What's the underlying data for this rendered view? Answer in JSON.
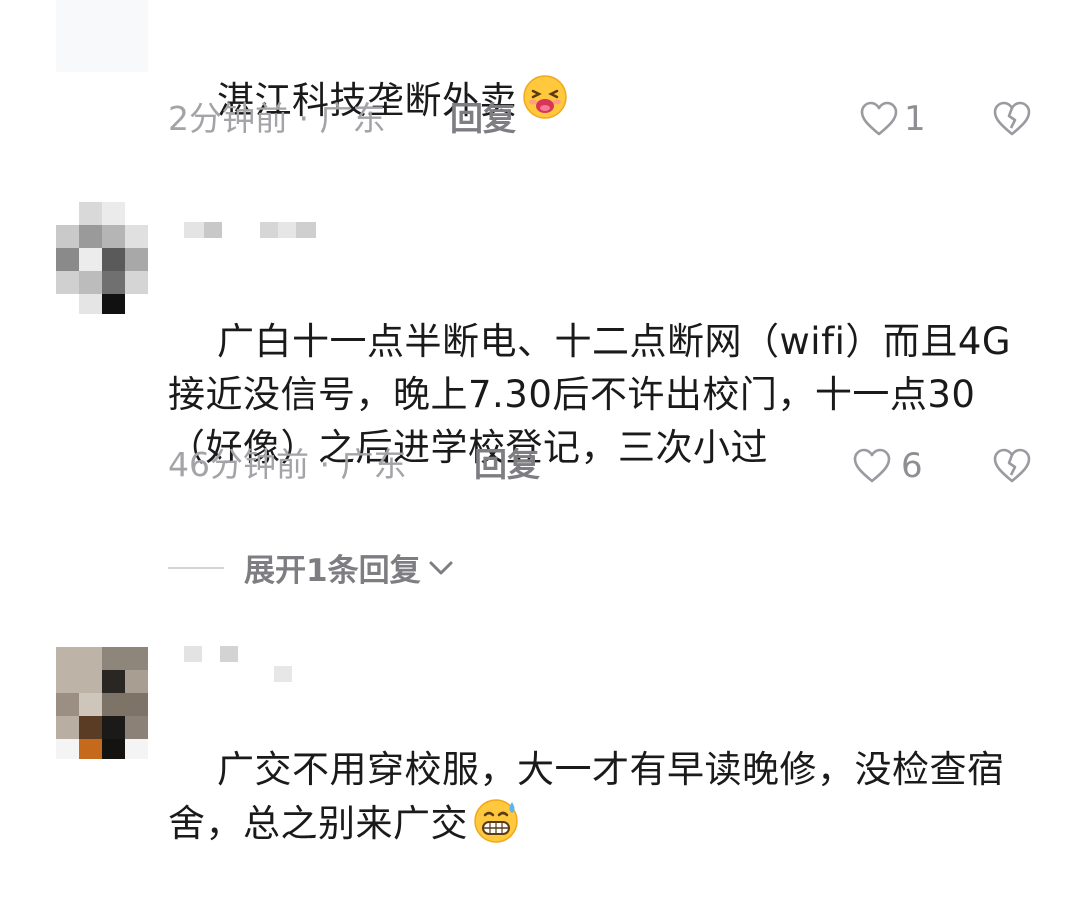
{
  "comments": [
    {
      "text": "湛江科技垄断外卖",
      "emoji_icon": "tongue-face-emoji",
      "time": "2分钟前",
      "location": "广东",
      "reply_label": "回复",
      "likes": "1"
    },
    {
      "text": "广白十一点半断电、十二点断网（wifi）而且4G接近没信号，晚上7.30后不许出校门，十一点30（好像）之后进学校登记，三次小过",
      "time": "46分钟前",
      "location": "广东",
      "reply_label": "回复",
      "likes": "6",
      "expand_label": "展开1条回复"
    },
    {
      "text": "广交不用穿校服，大一才有早读晚修，没检查宿舍，总之别来广交",
      "emoji_icon": "grinning-sweat-emoji",
      "time": "",
      "location": "",
      "reply_label": "",
      "likes": ""
    }
  ],
  "separator": "·",
  "colors": {
    "text": "#1a1a1a",
    "meta": "#a3a3a8",
    "reply": "#7d7d82",
    "icon": "#8e8e93"
  }
}
